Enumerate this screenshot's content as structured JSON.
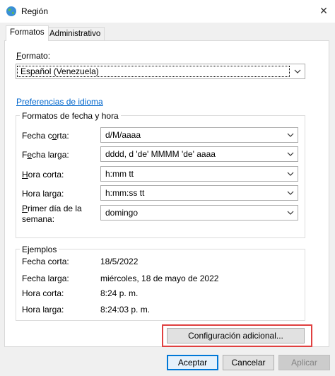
{
  "window": {
    "title": "Región",
    "close_glyph": "✕"
  },
  "tabs": [
    {
      "label": "Formatos",
      "active": true
    },
    {
      "label": "Administrativo",
      "active": false
    }
  ],
  "format": {
    "label": "Formato:",
    "label_access_key": "F",
    "label_rest": "ormato:",
    "value": "Español (Venezuela)"
  },
  "language_prefs_link": "Preferencias de idioma",
  "date_time_group": {
    "title": "Formatos de fecha y hora",
    "rows": [
      {
        "label_key": "Fecha c",
        "label_ul": "o",
        "label_rest": "rta:",
        "value": "d/M/aaaa"
      },
      {
        "label_key": "F",
        "label_ul": "e",
        "label_rest": "cha larga:",
        "value": "dddd, d 'de' MMMM 'de' aaaa"
      },
      {
        "label_key": "",
        "label_ul": "H",
        "label_rest": "ora corta:",
        "value": "h:mm tt"
      },
      {
        "label_key": "Hora larga:",
        "label_ul": "",
        "label_rest": "",
        "value": "h:mm:ss tt"
      },
      {
        "label_key": "",
        "label_ul": "P",
        "label_rest": "rimer día de la",
        "label_line2": "semana:",
        "value": "domingo"
      }
    ]
  },
  "examples_group": {
    "title": "Ejemplos",
    "rows": [
      {
        "label": "Fecha corta:",
        "value": "18/5/2022"
      },
      {
        "label": "Fecha larga:",
        "value": "miércoles, 18 de mayo de 2022"
      },
      {
        "label": "Hora corta:",
        "value": "8:24 p. m."
      },
      {
        "label": "Hora larga:",
        "value": "8:24:03 p. m."
      }
    ]
  },
  "buttons": {
    "additional": "Configuración adicional...",
    "accept": "Aceptar",
    "cancel": "Cancelar",
    "apply": "Aplicar"
  },
  "colors": {
    "link": "#0066cc",
    "highlight": "#e04040",
    "default_button_border": "#0078d7"
  }
}
